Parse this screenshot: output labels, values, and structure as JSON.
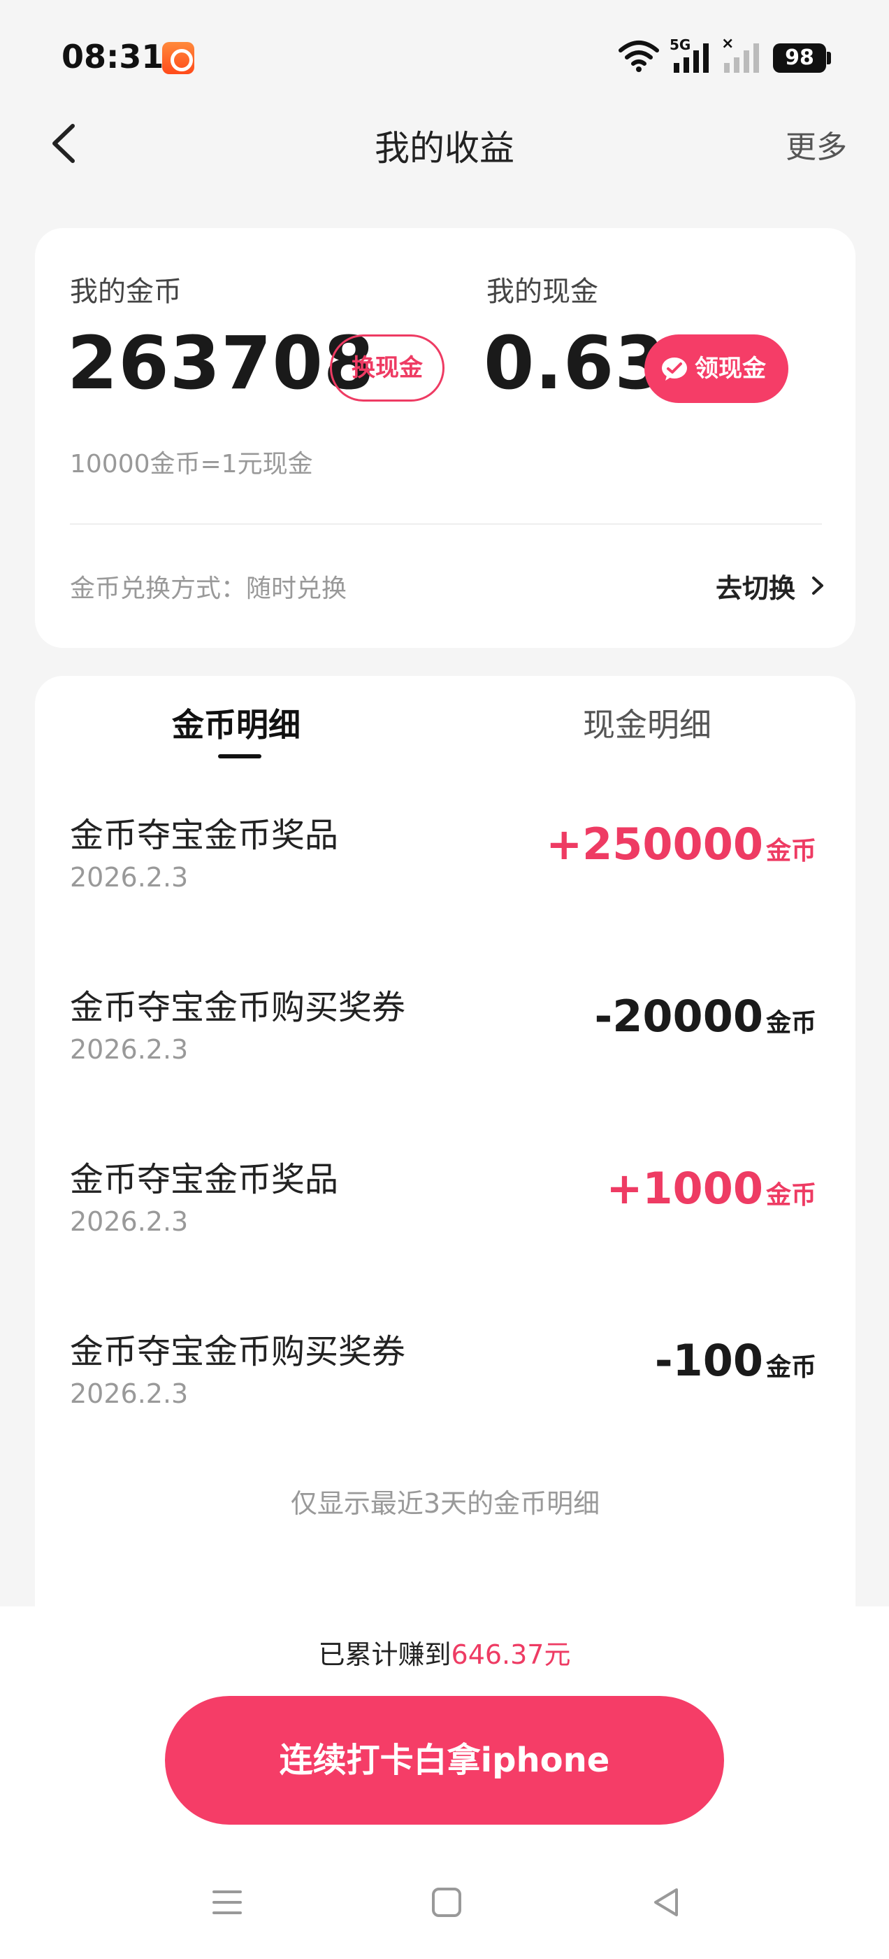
{
  "status_bar": {
    "time": "08:31",
    "network_label": "5G",
    "battery": "98"
  },
  "nav": {
    "title": "我的收益",
    "more": "更多"
  },
  "summary": {
    "coins_label": "我的金币",
    "coins_value": "263708",
    "exchange_button": "换现金",
    "cash_label": "我的现金",
    "cash_value": "0.63",
    "withdraw_button": "领现金",
    "rate_text": "10000金币=1元现金",
    "exchange_mode_text": "金币兑换方式：随时兑换",
    "switch_label": "去切换"
  },
  "detail": {
    "tabs": [
      {
        "label": "金币明细",
        "active": true
      },
      {
        "label": "现金明细",
        "active": false
      }
    ],
    "records": [
      {
        "title": "金币夺宝金币奖品",
        "date": "2026.2.3",
        "amount": "+250000",
        "unit": "金币",
        "positive": true
      },
      {
        "title": "金币夺宝金币购买奖券",
        "date": "2026.2.3",
        "amount": "-20000",
        "unit": "金币",
        "positive": false
      },
      {
        "title": "金币夺宝金币奖品",
        "date": "2026.2.3",
        "amount": "+1000",
        "unit": "金币",
        "positive": true
      },
      {
        "title": "金币夺宝金币购买奖券",
        "date": "2026.2.3",
        "amount": "-100",
        "unit": "金币",
        "positive": false
      }
    ],
    "footnote": "仅显示最近3天的金币明细"
  },
  "bottom": {
    "earned_prefix": "已累计赚到",
    "earned_value": "646.37元",
    "cta_label": "连续打卡白拿iphone"
  },
  "colors": {
    "accent": "#f53d67",
    "positive_amount": "#ee3b63",
    "background": "#f5f5f5"
  },
  "icons": {
    "back": "chevron-left-icon",
    "wechat": "wechat-icon",
    "switch_arrow": "chevron-right-icon",
    "system_nav": [
      "menu-icon",
      "home-square-icon",
      "back-triangle-icon"
    ]
  }
}
